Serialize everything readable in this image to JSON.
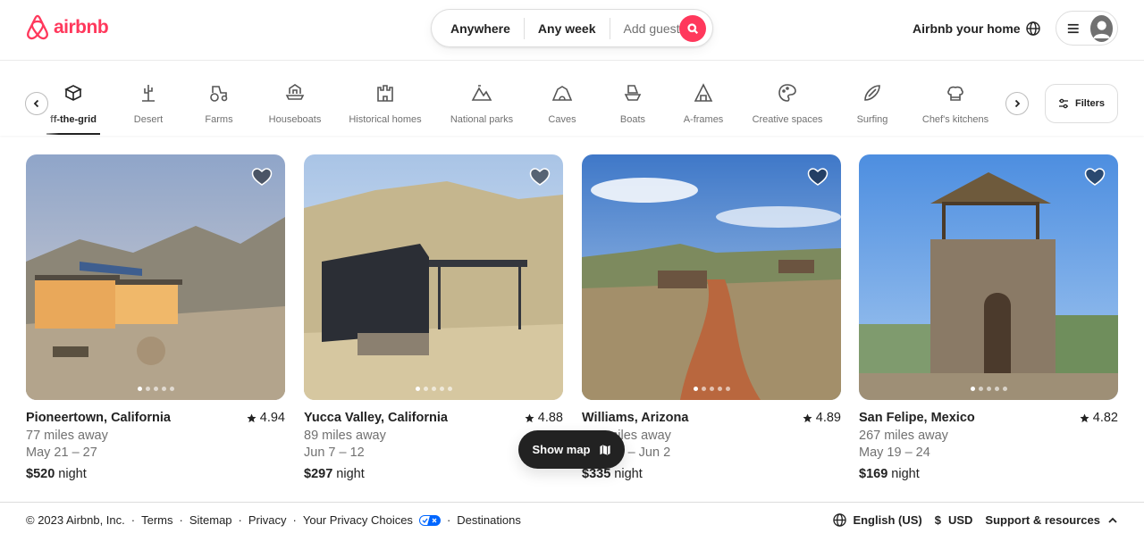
{
  "header": {
    "logo_text": "airbnb",
    "search": {
      "where": "Anywhere",
      "when": "Any week",
      "who": "Add guests"
    },
    "host_link": "Airbnb your home",
    "brand_color": "#ff385c"
  },
  "categories": [
    {
      "label": "ff-the-grid",
      "icon": "off-grid-icon",
      "active": true
    },
    {
      "label": "Desert",
      "icon": "cactus-icon"
    },
    {
      "label": "Farms",
      "icon": "tractor-icon"
    },
    {
      "label": "Houseboats",
      "icon": "houseboat-icon"
    },
    {
      "label": "Historical homes",
      "icon": "castle-icon"
    },
    {
      "label": "National parks",
      "icon": "mountains-icon"
    },
    {
      "label": "Caves",
      "icon": "cave-icon"
    },
    {
      "label": "Boats",
      "icon": "boat-icon"
    },
    {
      "label": "A-frames",
      "icon": "a-frame-icon"
    },
    {
      "label": "Creative spaces",
      "icon": "palette-icon"
    },
    {
      "label": "Surfing",
      "icon": "surfboard-icon"
    },
    {
      "label": "Chef's kitchens",
      "icon": "chef-hat-icon"
    }
  ],
  "filters_label": "Filters",
  "listings": [
    {
      "location": "Pioneertown, California",
      "distance": "77 miles away",
      "dates": "May 21 – 27",
      "price": "$520",
      "price_unit": "night",
      "rating": "4.94"
    },
    {
      "location": "Yucca Valley, California",
      "distance": "89 miles away",
      "dates": "Jun 7 – 12",
      "price": "$297",
      "price_unit": "night",
      "rating": "4.88"
    },
    {
      "location": "Williams, Arizona",
      "distance": "371 miles away",
      "dates": "May 28 – Jun 2",
      "price": "$335",
      "price_unit": "night",
      "rating": "4.89"
    },
    {
      "location": "San Felipe, Mexico",
      "distance": "267 miles away",
      "dates": "May 19 – 24",
      "price": "$169",
      "price_unit": "night",
      "rating": "4.82"
    }
  ],
  "show_map_label": "Show map",
  "footer": {
    "copyright": "© 2023 Airbnb, Inc.",
    "links": [
      "Terms",
      "Sitemap",
      "Privacy",
      "Your Privacy Choices",
      "Destinations"
    ],
    "language": "English (US)",
    "currency_symbol": "$",
    "currency": "USD",
    "support": "Support & resources"
  }
}
